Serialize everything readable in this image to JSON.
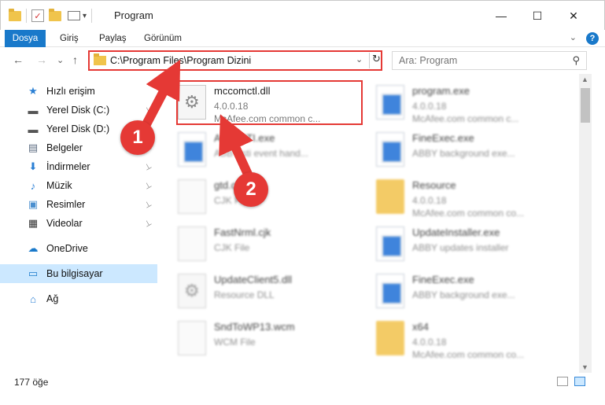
{
  "window": {
    "title": "Program",
    "minimize_glyph": "—",
    "maximize_glyph": "☐",
    "close_glyph": "✕",
    "quick_access": {
      "properties_icon": "check-icon",
      "new_folder_icon": "folder-icon",
      "customize_glyph": "▾"
    }
  },
  "ribbon": {
    "tabs": [
      "Dosya",
      "Giriş",
      "Paylaş",
      "Görünüm"
    ],
    "expand_glyph": "⌄",
    "help_glyph": "?",
    "accent": "#1979ca"
  },
  "nav": {
    "back_glyph": "←",
    "forward_glyph": "→",
    "recent_glyph": "⌄",
    "up_glyph": "↑",
    "address_path": "C:\\Program Files\\Program Dizini",
    "address_dropdown_glyph": "⌄",
    "refresh_glyph": "↻",
    "search_placeholder": "Ara: Program",
    "search_glyph": "⚲"
  },
  "sidebar": {
    "items": [
      {
        "label": "Hızlı erişim",
        "icon": "star-icon",
        "glyph": "★",
        "color": "#2a7fd4",
        "pinned": false
      },
      {
        "label": "Yerel Disk (C:)",
        "icon": "drive-icon",
        "glyph": "▬",
        "color": "#555555",
        "pinned": true
      },
      {
        "label": "Yerel Disk (D:)",
        "icon": "drive-icon",
        "glyph": "▬",
        "color": "#555555",
        "pinned": true
      },
      {
        "label": "Belgeler",
        "icon": "document-icon",
        "glyph": "▤",
        "color": "#5b6b80",
        "pinned": true
      },
      {
        "label": "İndirmeler",
        "icon": "download-icon",
        "glyph": "⬇",
        "color": "#2a7fd4",
        "pinned": true
      },
      {
        "label": "Müzik",
        "icon": "music-icon",
        "glyph": "♪",
        "color": "#2a7fd4",
        "pinned": true
      },
      {
        "label": "Resimler",
        "icon": "picture-icon",
        "glyph": "▣",
        "color": "#4a8fcf",
        "pinned": true
      },
      {
        "label": "Videolar",
        "icon": "video-icon",
        "glyph": "▦",
        "color": "#333333",
        "pinned": true
      },
      {
        "label": "OneDrive",
        "icon": "cloud-icon",
        "glyph": "☁",
        "color": "#1979ca",
        "pinned": false
      },
      {
        "label": "Bu bilgisayar",
        "icon": "computer-icon",
        "glyph": "▭",
        "color": "#1979ca",
        "pinned": false,
        "selected": true
      },
      {
        "label": "Ağ",
        "icon": "network-icon",
        "glyph": "⌂",
        "color": "#2a7fd4",
        "pinned": false
      }
    ],
    "pin_glyph": "📌"
  },
  "files": [
    {
      "name": "mccomctl.dll",
      "line2": "4.0.0.18",
      "line3": "McAfee.com common c...",
      "kind": "dll"
    },
    {
      "name": "program.exe",
      "line2": "4.0.0.18",
      "line3": "McAfee.com common c...",
      "kind": "exe"
    },
    {
      "name": "ApplySTI.exe",
      "line2": "ABBY sti event hand...",
      "line3": "",
      "kind": "exe"
    },
    {
      "name": "FineExec.exe",
      "line2": "ABBY background exe...",
      "line3": "",
      "kind": "exe"
    },
    {
      "name": "gtd.cjk",
      "line2": "CJK File",
      "line3": "",
      "kind": "page"
    },
    {
      "name": "Resource",
      "line2": "4.0.0.18",
      "line3": "McAfee.com common co...",
      "kind": "folder"
    },
    {
      "name": "FastNrml.cjk",
      "line2": "CJK File",
      "line3": "",
      "kind": "page"
    },
    {
      "name": "UpdateInstaller.exe",
      "line2": "ABBY updates installer",
      "line3": "",
      "kind": "exe"
    },
    {
      "name": "UpdateClient5.dll",
      "line2": "Resource DLL",
      "line3": "",
      "kind": "dll"
    },
    {
      "name": "FineExec.exe",
      "line2": "ABBY background exe...",
      "line3": "",
      "kind": "exe"
    },
    {
      "name": "SndToWP13.wcm",
      "line2": "WCM File",
      "line3": "",
      "kind": "page"
    },
    {
      "name": "x64",
      "line2": "4.0.0.18",
      "line3": "McAfee.com common co...",
      "kind": "folder"
    }
  ],
  "status": {
    "item_count": "177 öğe"
  },
  "annotations": {
    "step1": "1",
    "step2": "2",
    "accent": "#e53935"
  },
  "scrollbar": {
    "up_glyph": "▲",
    "down_glyph": "▼"
  }
}
